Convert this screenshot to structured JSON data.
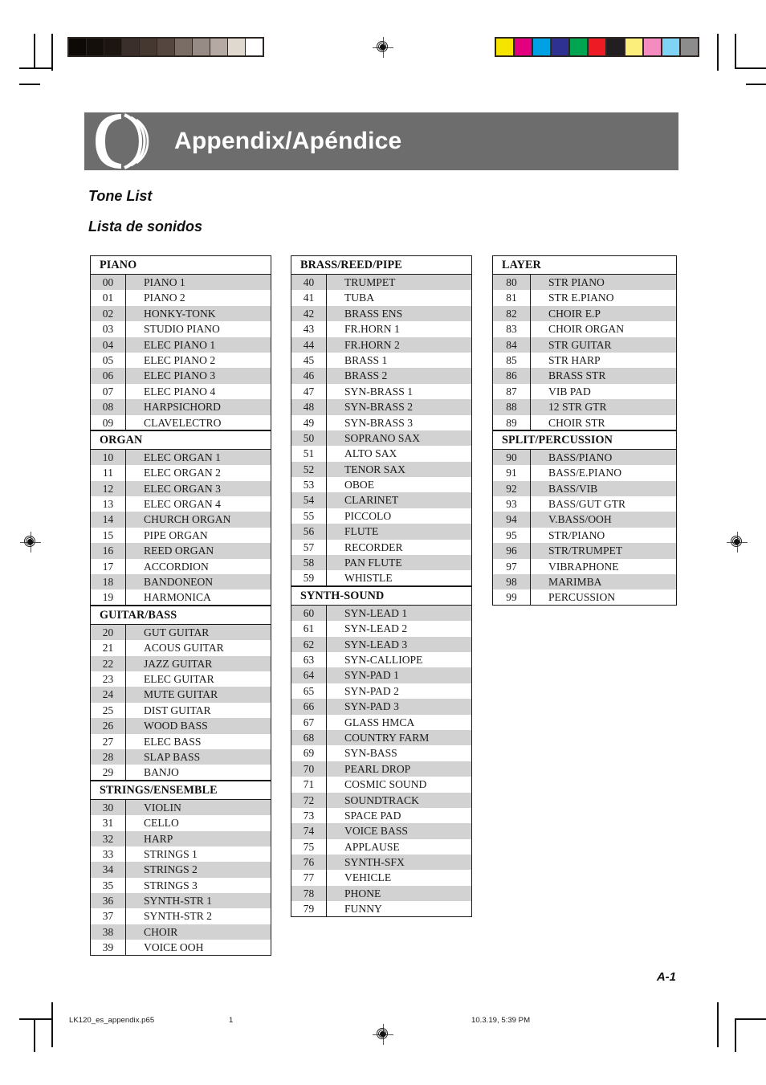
{
  "header": {
    "title": "Appendix/Apéndice",
    "logo": "casio-arc-logo"
  },
  "subtitles": {
    "english": "Tone List",
    "spanish": "Lista de sonidos"
  },
  "footer": {
    "page_number": "A-1",
    "file_name": "LK120_es_appendix.p65",
    "sheet_number": "1",
    "timestamp": "10.3.19, 5:39 PM"
  },
  "print_marks": {
    "gray_ramp": [
      "#0d0907",
      "#150f0c",
      "#1d1511",
      "#3a2f2a",
      "#453830",
      "#554740",
      "#7a6d66",
      "#968b85",
      "#b5aaa3",
      "#dfd9d0",
      "#ffffff"
    ],
    "color_bar": [
      "#f5e400",
      "#e3007f",
      "#00a0e4",
      "#2e3192",
      "#00a551",
      "#ed1c24",
      "#231f20",
      "#fbee7a",
      "#f48cc0",
      "#7fd3f4",
      "#8c8c8c"
    ]
  },
  "columns": [
    {
      "id": "column-1",
      "sections": [
        {
          "heading": "PIANO",
          "tones": [
            {
              "num": "00",
              "name": "PIANO 1"
            },
            {
              "num": "01",
              "name": "PIANO 2"
            },
            {
              "num": "02",
              "name": "HONKY-TONK"
            },
            {
              "num": "03",
              "name": "STUDIO PIANO"
            },
            {
              "num": "04",
              "name": "ELEC PIANO 1"
            },
            {
              "num": "05",
              "name": "ELEC PIANO 2"
            },
            {
              "num": "06",
              "name": "ELEC PIANO 3"
            },
            {
              "num": "07",
              "name": "ELEC PIANO 4"
            },
            {
              "num": "08",
              "name": "HARPSICHORD"
            },
            {
              "num": "09",
              "name": "CLAVELECTRO"
            }
          ]
        },
        {
          "heading": "ORGAN",
          "tones": [
            {
              "num": "10",
              "name": "ELEC ORGAN 1"
            },
            {
              "num": "11",
              "name": "ELEC ORGAN 2"
            },
            {
              "num": "12",
              "name": "ELEC ORGAN 3"
            },
            {
              "num": "13",
              "name": "ELEC ORGAN 4"
            },
            {
              "num": "14",
              "name": "CHURCH ORGAN"
            },
            {
              "num": "15",
              "name": "PIPE ORGAN"
            },
            {
              "num": "16",
              "name": "REED ORGAN"
            },
            {
              "num": "17",
              "name": "ACCORDION"
            },
            {
              "num": "18",
              "name": "BANDONEON"
            },
            {
              "num": "19",
              "name": "HARMONICA"
            }
          ]
        },
        {
          "heading": "GUITAR/BASS",
          "tones": [
            {
              "num": "20",
              "name": "GUT GUITAR"
            },
            {
              "num": "21",
              "name": "ACOUS GUITAR"
            },
            {
              "num": "22",
              "name": "JAZZ GUITAR"
            },
            {
              "num": "23",
              "name": "ELEC GUITAR"
            },
            {
              "num": "24",
              "name": "MUTE GUITAR"
            },
            {
              "num": "25",
              "name": "DIST GUITAR"
            },
            {
              "num": "26",
              "name": "WOOD BASS"
            },
            {
              "num": "27",
              "name": "ELEC BASS"
            },
            {
              "num": "28",
              "name": "SLAP BASS"
            },
            {
              "num": "29",
              "name": "BANJO"
            }
          ]
        },
        {
          "heading": "STRINGS/ENSEMBLE",
          "tones": [
            {
              "num": "30",
              "name": "VIOLIN"
            },
            {
              "num": "31",
              "name": "CELLO"
            },
            {
              "num": "32",
              "name": "HARP"
            },
            {
              "num": "33",
              "name": "STRINGS 1"
            },
            {
              "num": "34",
              "name": "STRINGS 2"
            },
            {
              "num": "35",
              "name": "STRINGS 3"
            },
            {
              "num": "36",
              "name": "SYNTH-STR 1"
            },
            {
              "num": "37",
              "name": "SYNTH-STR 2"
            },
            {
              "num": "38",
              "name": "CHOIR"
            },
            {
              "num": "39",
              "name": "VOICE OOH"
            }
          ]
        }
      ]
    },
    {
      "id": "column-2",
      "sections": [
        {
          "heading": "BRASS/REED/PIPE",
          "tones": [
            {
              "num": "40",
              "name": "TRUMPET"
            },
            {
              "num": "41",
              "name": "TUBA"
            },
            {
              "num": "42",
              "name": "BRASS ENS"
            },
            {
              "num": "43",
              "name": "FR.HORN 1"
            },
            {
              "num": "44",
              "name": "FR.HORN 2"
            },
            {
              "num": "45",
              "name": "BRASS 1"
            },
            {
              "num": "46",
              "name": "BRASS 2"
            },
            {
              "num": "47",
              "name": "SYN-BRASS 1"
            },
            {
              "num": "48",
              "name": "SYN-BRASS 2"
            },
            {
              "num": "49",
              "name": "SYN-BRASS 3"
            },
            {
              "num": "50",
              "name": "SOPRANO SAX"
            },
            {
              "num": "51",
              "name": "ALTO SAX"
            },
            {
              "num": "52",
              "name": "TENOR SAX"
            },
            {
              "num": "53",
              "name": "OBOE"
            },
            {
              "num": "54",
              "name": "CLARINET"
            },
            {
              "num": "55",
              "name": "PICCOLO"
            },
            {
              "num": "56",
              "name": "FLUTE"
            },
            {
              "num": "57",
              "name": "RECORDER"
            },
            {
              "num": "58",
              "name": "PAN FLUTE"
            },
            {
              "num": "59",
              "name": "WHISTLE"
            }
          ]
        },
        {
          "heading": "SYNTH-SOUND",
          "tones": [
            {
              "num": "60",
              "name": "SYN-LEAD 1"
            },
            {
              "num": "61",
              "name": "SYN-LEAD 2"
            },
            {
              "num": "62",
              "name": "SYN-LEAD 3"
            },
            {
              "num": "63",
              "name": "SYN-CALLIOPE"
            },
            {
              "num": "64",
              "name": "SYN-PAD 1"
            },
            {
              "num": "65",
              "name": "SYN-PAD 2"
            },
            {
              "num": "66",
              "name": "SYN-PAD 3"
            },
            {
              "num": "67",
              "name": "GLASS HMCA"
            },
            {
              "num": "68",
              "name": "COUNTRY FARM"
            },
            {
              "num": "69",
              "name": "SYN-BASS"
            },
            {
              "num": "70",
              "name": "PEARL DROP"
            },
            {
              "num": "71",
              "name": "COSMIC SOUND"
            },
            {
              "num": "72",
              "name": "SOUNDTRACK"
            },
            {
              "num": "73",
              "name": "SPACE PAD"
            },
            {
              "num": "74",
              "name": "VOICE BASS"
            },
            {
              "num": "75",
              "name": "APPLAUSE"
            },
            {
              "num": "76",
              "name": "SYNTH-SFX"
            },
            {
              "num": "77",
              "name": "VEHICLE"
            },
            {
              "num": "78",
              "name": "PHONE"
            },
            {
              "num": "79",
              "name": "FUNNY"
            }
          ]
        }
      ]
    },
    {
      "id": "column-3",
      "sections": [
        {
          "heading": "LAYER",
          "tones": [
            {
              "num": "80",
              "name": "STR PIANO"
            },
            {
              "num": "81",
              "name": "STR E.PIANO"
            },
            {
              "num": "82",
              "name": "CHOIR E.P"
            },
            {
              "num": "83",
              "name": "CHOIR ORGAN"
            },
            {
              "num": "84",
              "name": "STR GUITAR"
            },
            {
              "num": "85",
              "name": "STR HARP"
            },
            {
              "num": "86",
              "name": "BRASS STR"
            },
            {
              "num": "87",
              "name": "VIB PAD"
            },
            {
              "num": "88",
              "name": "12 STR GTR"
            },
            {
              "num": "89",
              "name": "CHOIR STR"
            }
          ]
        },
        {
          "heading": "SPLIT/PERCUSSION",
          "tones": [
            {
              "num": "90",
              "name": "BASS/PIANO"
            },
            {
              "num": "91",
              "name": "BASS/E.PIANO"
            },
            {
              "num": "92",
              "name": "BASS/VIB"
            },
            {
              "num": "93",
              "name": "BASS/GUT GTR"
            },
            {
              "num": "94",
              "name": "V.BASS/OOH"
            },
            {
              "num": "95",
              "name": "STR/PIANO"
            },
            {
              "num": "96",
              "name": "STR/TRUMPET"
            },
            {
              "num": "97",
              "name": "VIBRAPHONE"
            },
            {
              "num": "98",
              "name": "MARIMBA"
            },
            {
              "num": "99",
              "name": "PERCUSSION"
            }
          ]
        }
      ]
    }
  ]
}
